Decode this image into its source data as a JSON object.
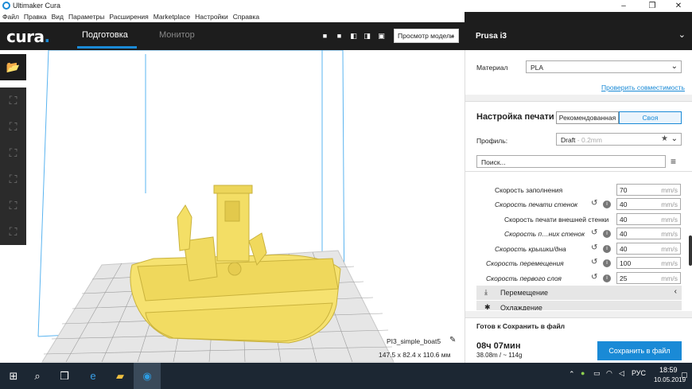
{
  "window": {
    "title": "Ultimaker Cura",
    "minimize": "–",
    "maximize": "❐",
    "close": "✕"
  },
  "menu": [
    "Файл",
    "Правка",
    "Вид",
    "Параметры",
    "Расширения",
    "Marketplace",
    "Настройки",
    "Справка"
  ],
  "header": {
    "logo": "cura",
    "tabs": {
      "prepare": "Подготовка",
      "monitor": "Монитор"
    },
    "view_mode": "Просмотр модели"
  },
  "printer": {
    "name": "Prusa i3"
  },
  "panel": {
    "material_label": "Материал",
    "material_value": "PLA",
    "compat_link": "Проверить совместимость",
    "print_settings_title": "Настройка печати",
    "mode_recommended": "Рекомендованная",
    "mode_custom": "Своя",
    "profile_label": "Профиль:",
    "profile_value": "Draft",
    "profile_layer": "- 0.2mm",
    "search_placeholder": "Поиск...",
    "settings": [
      {
        "label": "Скорость заполнения",
        "value": "70",
        "unit": "mm/s",
        "italic": false,
        "indent": 1,
        "reset": false
      },
      {
        "label": "Скорость печати стенок",
        "value": "40",
        "unit": "mm/s",
        "italic": true,
        "indent": 1,
        "reset": true
      },
      {
        "label": "Скорость печати внешней стенки",
        "value": "40",
        "unit": "mm/s",
        "italic": false,
        "indent": 2,
        "reset": false
      },
      {
        "label": "Скорость п…них стенок",
        "value": "40",
        "unit": "mm/s",
        "italic": true,
        "indent": 2,
        "reset": true
      },
      {
        "label": "Скорость крышки/дна",
        "value": "40",
        "unit": "mm/s",
        "italic": true,
        "indent": 1,
        "reset": true
      },
      {
        "label": "Скорость перемещения",
        "value": "100",
        "unit": "mm/s",
        "italic": true,
        "indent": 0,
        "reset": true
      },
      {
        "label": "Скорость первого слоя",
        "value": "25",
        "unit": "mm/s",
        "italic": true,
        "indent": 0,
        "reset": true
      }
    ],
    "categories": {
      "travel": "Перемещение",
      "cooling": "Охлаждение"
    },
    "save_status": "Готов к Сохранить в файл",
    "print_time": "08ч 07мин",
    "material_usage": "38.08m / ~ 114g",
    "save_button": "Сохранить в файл"
  },
  "model": {
    "name": "PI3_simple_boat5",
    "dimensions": "147.5 x 82.4 x 110.6 мм"
  },
  "taskbar": {
    "language": "РУС",
    "time": "18:59",
    "date": "10.05.2019"
  }
}
